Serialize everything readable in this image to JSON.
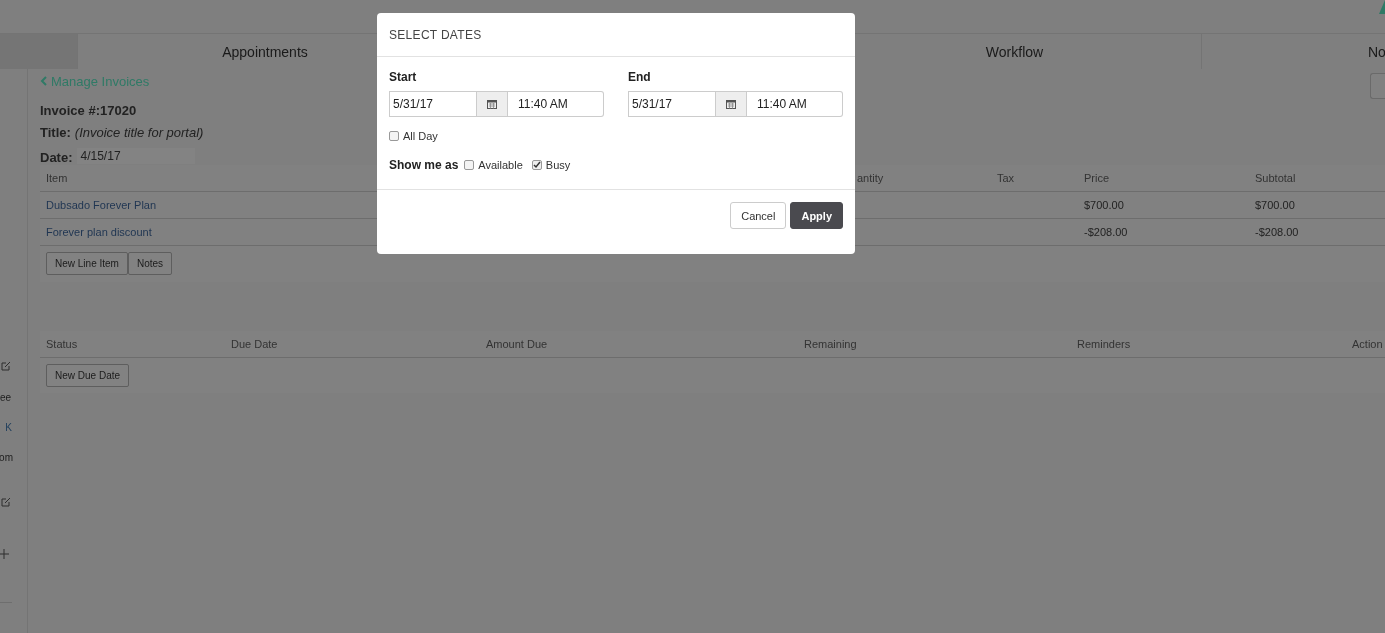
{
  "nav_tabs": [
    {
      "label": "Appointments"
    },
    {
      "label": "Workflow"
    },
    {
      "label": "No"
    }
  ],
  "sidebar": {
    "texts": [
      {
        "text": "ee",
        "kind": "text"
      },
      {
        "text": "K",
        "kind": "link"
      },
      {
        "text": "om",
        "kind": "text"
      }
    ]
  },
  "back_link": "Manage Invoices",
  "invoice": {
    "number": "Invoice #:17020",
    "title_label": "Title:",
    "title_value": "(Invoice title for portal)",
    "date_label": "Date:",
    "date_value": "4/15/17"
  },
  "items_table": {
    "columns": [
      "Item",
      "antity",
      "Tax",
      "Price",
      "Subtotal"
    ],
    "rows": [
      [
        "Dubsado Forever Plan",
        "",
        "",
        "$700.00",
        "$700.00"
      ],
      [
        "Forever plan discount",
        "",
        "",
        "-$208.00",
        "-$208.00"
      ]
    ],
    "buttons": [
      "New Line Item",
      "Notes"
    ]
  },
  "payments_table": {
    "columns": [
      "Status",
      "Due Date",
      "Amount Due",
      "Remaining",
      "Reminders",
      "Action"
    ],
    "buttons": [
      "New Due Date"
    ]
  },
  "modal": {
    "title": "SELECT DATES",
    "start": {
      "label": "Start",
      "date": "5/31/17",
      "time": "11:40 AM"
    },
    "end": {
      "label": "End",
      "date": "5/31/17",
      "time": "11:40 AM"
    },
    "all_day": {
      "label": "All Day",
      "checked": false
    },
    "show_me_as": {
      "label": "Show me as",
      "options": [
        {
          "label": "Available",
          "checked": false
        },
        {
          "label": "Busy",
          "checked": true
        }
      ]
    },
    "buttons": [
      {
        "label": "Cancel",
        "kind": "default"
      },
      {
        "label": "Apply",
        "kind": "primary"
      }
    ]
  }
}
